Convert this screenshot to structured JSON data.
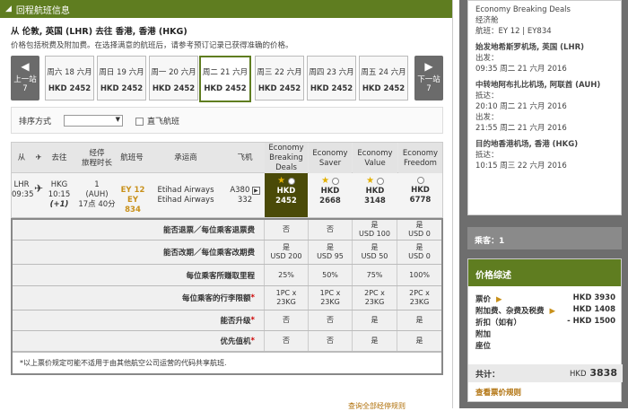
{
  "header": {
    "title": "回程航班信息"
  },
  "route": {
    "title": "从 伦敦, 英国 (LHR) 去往 香港, 香港 (HKG)",
    "subtitle": "价格包括税费及附加费。在选择满意的航班后，请参考预订记录已获得准确的价格。"
  },
  "nav": {
    "prev_label": "上一站",
    "prev_num": "7",
    "next_label": "下一站",
    "next_num": "7",
    "prev_arrow": "◀",
    "next_arrow": "▶"
  },
  "dates": [
    {
      "day": "周六 18 六月",
      "price": "HKD 2452"
    },
    {
      "day": "周日 19 六月",
      "price": "HKD 2452"
    },
    {
      "day": "周一 20 六月",
      "price": "HKD 2452"
    },
    {
      "day": "周二 21 六月",
      "price": "HKD 2452"
    },
    {
      "day": "周三 22 六月",
      "price": "HKD 2452"
    },
    {
      "day": "周四 23 六月",
      "price": "HKD 2452"
    },
    {
      "day": "周五 24 六月",
      "price": "HKD 2452"
    }
  ],
  "sort": {
    "label": "排序方式",
    "value": "",
    "direct_label": "直飞航班"
  },
  "table": {
    "headers": {
      "from": "从",
      "to": "去往",
      "duration": "经停\n旅程时长",
      "flightno": "航班号",
      "carrier": "承运商",
      "aircraft": "飞机",
      "breaking": "Economy\nBreaking\nDeals",
      "saver": "Economy\nSaver",
      "value": "Economy\nValue",
      "freedom": "Economy\nFreedom"
    },
    "flight": {
      "from_code": "LHR",
      "from_time": "09:35",
      "to_code": "HKG",
      "to_time": "10:15",
      "to_offset": "(+1)",
      "stops": "1",
      "via": "(AUH)",
      "duration": "17点 40分",
      "flight1": "EY 12",
      "flight2": "EY 834",
      "carrier1": "Etihad Airways",
      "carrier2": "Etihad Airways",
      "aircraft1": "A380",
      "aircraft2": "332",
      "breaking_price": "HKD\n2452",
      "saver_price": "HKD\n2668",
      "value_price": "HKD\n3148",
      "freedom_price": "HKD\n6778"
    }
  },
  "details": [
    {
      "label": "能否退票／每位乘客退票费",
      "req": "",
      "v": [
        "否",
        "否",
        "是\nUSD 100",
        "是\nUSD 0"
      ]
    },
    {
      "label": "能否改期／每位乘客改期费",
      "req": "",
      "v": [
        "是\nUSD 200",
        "是\nUSD 95",
        "是\nUSD 50",
        "是\nUSD 0"
      ]
    },
    {
      "label": "每位乘客所赚取里程",
      "req": "",
      "v": [
        "25%",
        "50%",
        "75%",
        "100%"
      ]
    },
    {
      "label": "每位乘客的行李限额",
      "req": "*",
      "v": [
        "1PC x\n23KG",
        "1PC x\n23KG",
        "2PC x\n23KG",
        "2PC x\n23KG"
      ]
    },
    {
      "label": "能否升级",
      "req": "*",
      "v": [
        "否",
        "否",
        "是",
        "是"
      ]
    },
    {
      "label": "优先值机",
      "req": "*",
      "v": [
        "否",
        "否",
        "是",
        "是"
      ]
    }
  ],
  "note": "*以上票价规定可能不适用于由其他航空公司运营的代码共享航班.",
  "bottom_link": "查询全部经停规则",
  "summary": {
    "fare": "Economy Breaking Deals",
    "cabin": "经济舱",
    "flight": "航班：EY 12 | EY834",
    "origin": "始发地希斯罗机场, 英国 (LHR)",
    "dep_label": "出发：",
    "dep": "09:35 周二 21 六月 2016",
    "transit": "中转地阿布扎比机场, 阿联酋 (AUH)",
    "arr_label": "抵达：",
    "arr": "20:10 周二 21 六月 2016",
    "dep2_label": "出发：",
    "dep2": "21:55 周二 21 六月 2016",
    "dest": "目的地香港机场, 香港 (HKG)",
    "arr2_label": "抵达：",
    "arr2": "10:15 周三 22 六月 2016"
  },
  "passengers": "乘客：1",
  "price": {
    "title": "价格综述",
    "rows": [
      {
        "label": "票价",
        "arrow": "▶",
        "amount": "HKD 3930"
      },
      {
        "label": "附加费、杂费及税费",
        "arrow": "▶",
        "amount": "HKD 1408"
      },
      {
        "label": "折扣（如有）",
        "arrow": "",
        "amount": "- HKD 1500"
      },
      {
        "label": "附加",
        "arrow": "",
        "amount": ""
      },
      {
        "label": "座位",
        "arrow": "",
        "amount": ""
      }
    ],
    "total_label": "共计：",
    "total_currency": "HKD",
    "total": "3838",
    "rules_link": "查看票价规则"
  }
}
